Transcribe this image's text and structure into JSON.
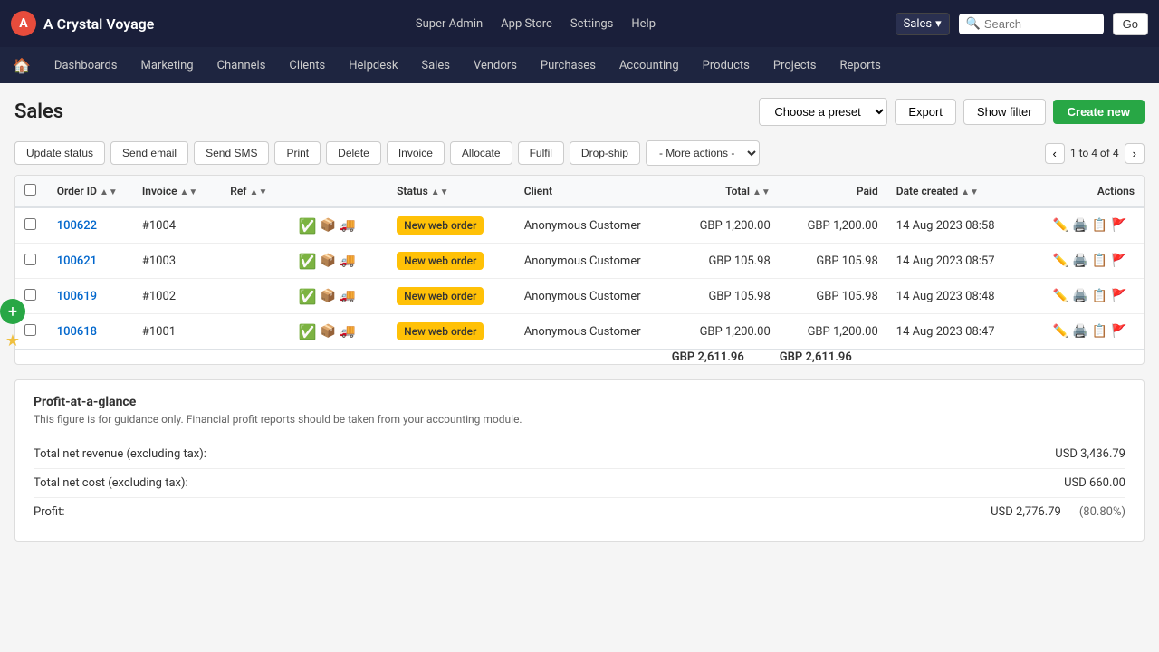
{
  "brand": {
    "logo_text": "A",
    "name": "A Crystal Voyage"
  },
  "top_nav": {
    "links": [
      "Super Admin",
      "App Store",
      "Settings",
      "Help"
    ],
    "sales_dropdown": "Sales",
    "search_placeholder": "Search",
    "go_label": "Go"
  },
  "sec_nav": {
    "links": [
      "Dashboards",
      "Marketing",
      "Channels",
      "Clients",
      "Helpdesk",
      "Sales",
      "Vendors",
      "Purchases",
      "Accounting",
      "Products",
      "Projects",
      "Reports"
    ]
  },
  "page": {
    "title": "Sales",
    "preset_placeholder": "Choose a preset",
    "export_label": "Export",
    "show_filter_label": "Show filter",
    "create_new_label": "Create new"
  },
  "toolbar": {
    "update_status": "Update status",
    "send_email": "Send email",
    "send_sms": "Send SMS",
    "print": "Print",
    "delete": "Delete",
    "invoice": "Invoice",
    "allocate": "Allocate",
    "fulfil": "Fulfil",
    "drop_ship": "Drop-ship",
    "more_actions": "- More actions -",
    "pagination_text": "1 to 4 of 4"
  },
  "table": {
    "columns": [
      "Order ID",
      "Invoice",
      "Ref",
      "Status",
      "Client",
      "Total",
      "Paid",
      "Date created",
      "Actions"
    ],
    "rows": [
      {
        "order_id": "100622",
        "invoice": "#1004",
        "ref": "",
        "status_badge": "New web order",
        "client": "Anonymous Customer",
        "total": "GBP 1,200.00",
        "paid": "GBP 1,200.00",
        "date": "14 Aug 2023 08:58"
      },
      {
        "order_id": "100621",
        "invoice": "#1003",
        "ref": "",
        "status_badge": "New web order",
        "client": "Anonymous Customer",
        "total": "GBP 105.98",
        "paid": "GBP 105.98",
        "date": "14 Aug 2023 08:57"
      },
      {
        "order_id": "100619",
        "invoice": "#1002",
        "ref": "",
        "status_badge": "New web order",
        "client": "Anonymous Customer",
        "total": "GBP 105.98",
        "paid": "GBP 105.98",
        "date": "14 Aug 2023 08:48"
      },
      {
        "order_id": "100618",
        "invoice": "#1001",
        "ref": "",
        "status_badge": "New web order",
        "client": "Anonymous Customer",
        "total": "GBP 1,200.00",
        "paid": "GBP 1,200.00",
        "date": "14 Aug 2023 08:47"
      }
    ],
    "totals": {
      "total": "GBP 2,611.96",
      "paid": "GBP 2,611.96"
    }
  },
  "profit": {
    "title": "Profit-at-a-glance",
    "subtitle": "This figure is for guidance only. Financial profit reports should be taken from your accounting module.",
    "rows": [
      {
        "label": "Total net revenue (excluding tax):",
        "value": "USD 3,436.79",
        "pct": ""
      },
      {
        "label": "Total net cost (excluding tax):",
        "value": "USD 660.00",
        "pct": ""
      },
      {
        "label": "Profit:",
        "value": "USD 2,776.79",
        "pct": "(80.80%)"
      }
    ]
  }
}
